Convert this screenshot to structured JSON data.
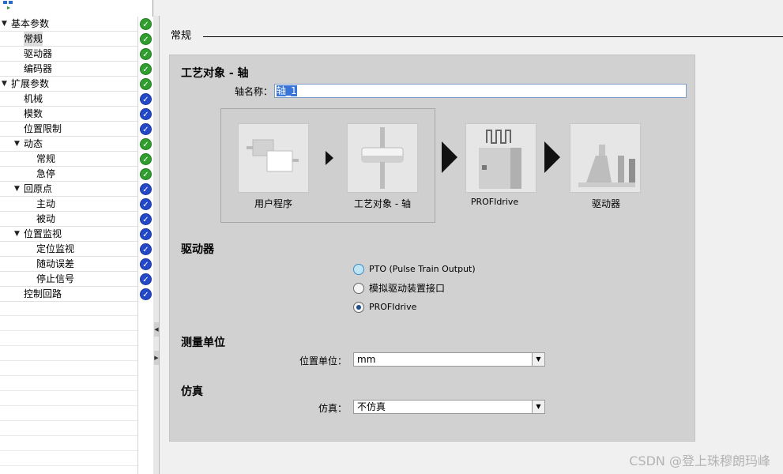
{
  "tree": {
    "items": [
      {
        "label": "基本参数",
        "level": 0,
        "expandable": true,
        "status": "green"
      },
      {
        "label": "常规",
        "level": 1,
        "selected": true,
        "status": "green"
      },
      {
        "label": "驱动器",
        "level": 1,
        "status": "green"
      },
      {
        "label": "编码器",
        "level": 1,
        "status": "green"
      },
      {
        "label": "扩展参数",
        "level": 0,
        "expandable": true,
        "status": "green"
      },
      {
        "label": "机械",
        "level": 1,
        "status": "blue"
      },
      {
        "label": "模数",
        "level": 1,
        "status": "blue"
      },
      {
        "label": "位置限制",
        "level": 1,
        "status": "blue"
      },
      {
        "label": "动态",
        "level": 1,
        "expandable": true,
        "status": "green"
      },
      {
        "label": "常规",
        "level": 2,
        "status": "green"
      },
      {
        "label": "急停",
        "level": 2,
        "status": "green"
      },
      {
        "label": "回原点",
        "level": 1,
        "expandable": true,
        "status": "blue"
      },
      {
        "label": "主动",
        "level": 2,
        "status": "blue"
      },
      {
        "label": "被动",
        "level": 2,
        "status": "blue"
      },
      {
        "label": "位置监视",
        "level": 1,
        "expandable": true,
        "status": "blue"
      },
      {
        "label": "定位监视",
        "level": 2,
        "status": "blue"
      },
      {
        "label": "随动误差",
        "level": 2,
        "status": "blue"
      },
      {
        "label": "停止信号",
        "level": 2,
        "status": "blue"
      },
      {
        "label": "控制回路",
        "level": 1,
        "status": "blue"
      }
    ]
  },
  "main": {
    "section_title": "常规",
    "tech_object": {
      "heading": "工艺对象 - 轴",
      "axis_name_label": "轴名称：",
      "axis_name_value": "轴_1"
    },
    "diagram": {
      "user_program": "用户程序",
      "tech_object_axis": "工艺对象 - 轴",
      "profidrive": "PROFIdrive",
      "drive": "驱动器"
    },
    "drive_section": {
      "heading": "驱动器",
      "options": [
        {
          "label": "PTO (Pulse Train Output)",
          "checked": false,
          "hover": true
        },
        {
          "label": "模拟驱动装置接口",
          "checked": false,
          "hover": false
        },
        {
          "label": "PROFIdrive",
          "checked": true,
          "hover": false
        }
      ]
    },
    "measure_section": {
      "heading": "测量单位",
      "position_unit_label": "位置单位：",
      "position_unit_value": "mm"
    },
    "simulation_section": {
      "heading": "仿真",
      "simulation_label": "仿真：",
      "simulation_value": "不仿真"
    }
  },
  "watermark": "CSDN @登上珠穆朗玛峰",
  "colors": {
    "status_green": "#2f9e2f",
    "status_blue": "#2348c8",
    "selection_blue": "#3874d8",
    "panel_bg": "#d1d1d1"
  }
}
